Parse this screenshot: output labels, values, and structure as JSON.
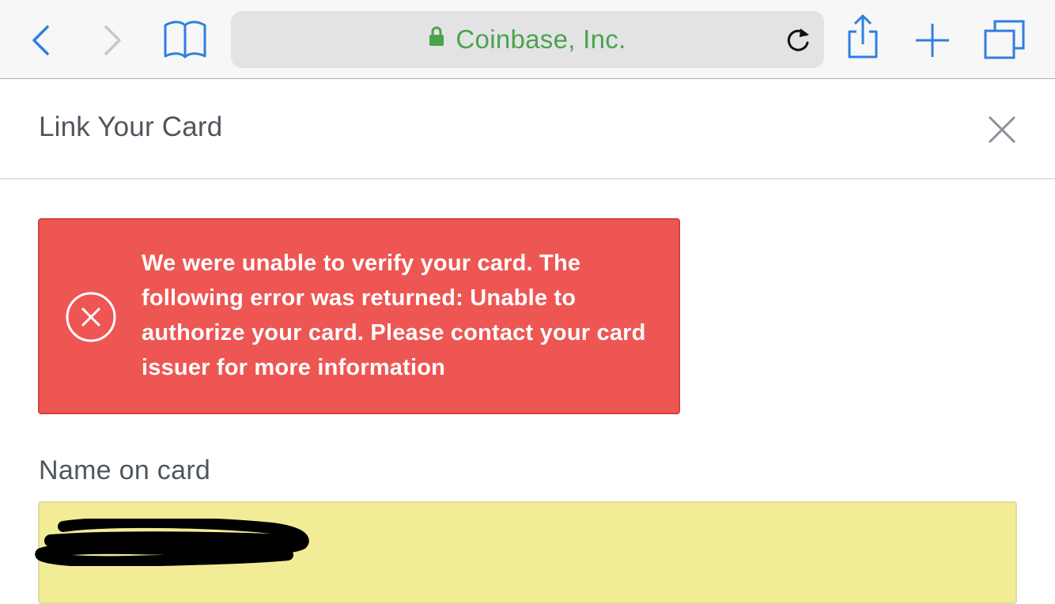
{
  "browser": {
    "url_text": "Coinbase, Inc.",
    "icons": [
      "back-icon",
      "forward-icon",
      "bookmarks-icon",
      "lock-icon",
      "reload-icon",
      "share-icon",
      "new-tab-icon",
      "tabs-icon"
    ],
    "colors": {
      "url_secure": "#4ba34b",
      "toolbar_icon": "#2f7fe0"
    }
  },
  "page": {
    "title": "Link Your Card",
    "close_icon": "close-icon"
  },
  "error": {
    "message": "We were unable to verify your card. The following error was returned: Unable to authorize your card. Please contact your card issuer for more information",
    "icon": "error-circle-x-icon",
    "color": "#ee5653"
  },
  "form": {
    "name_label": "Name on card",
    "name_value_redacted": true,
    "input_color": "#f3ec96"
  }
}
